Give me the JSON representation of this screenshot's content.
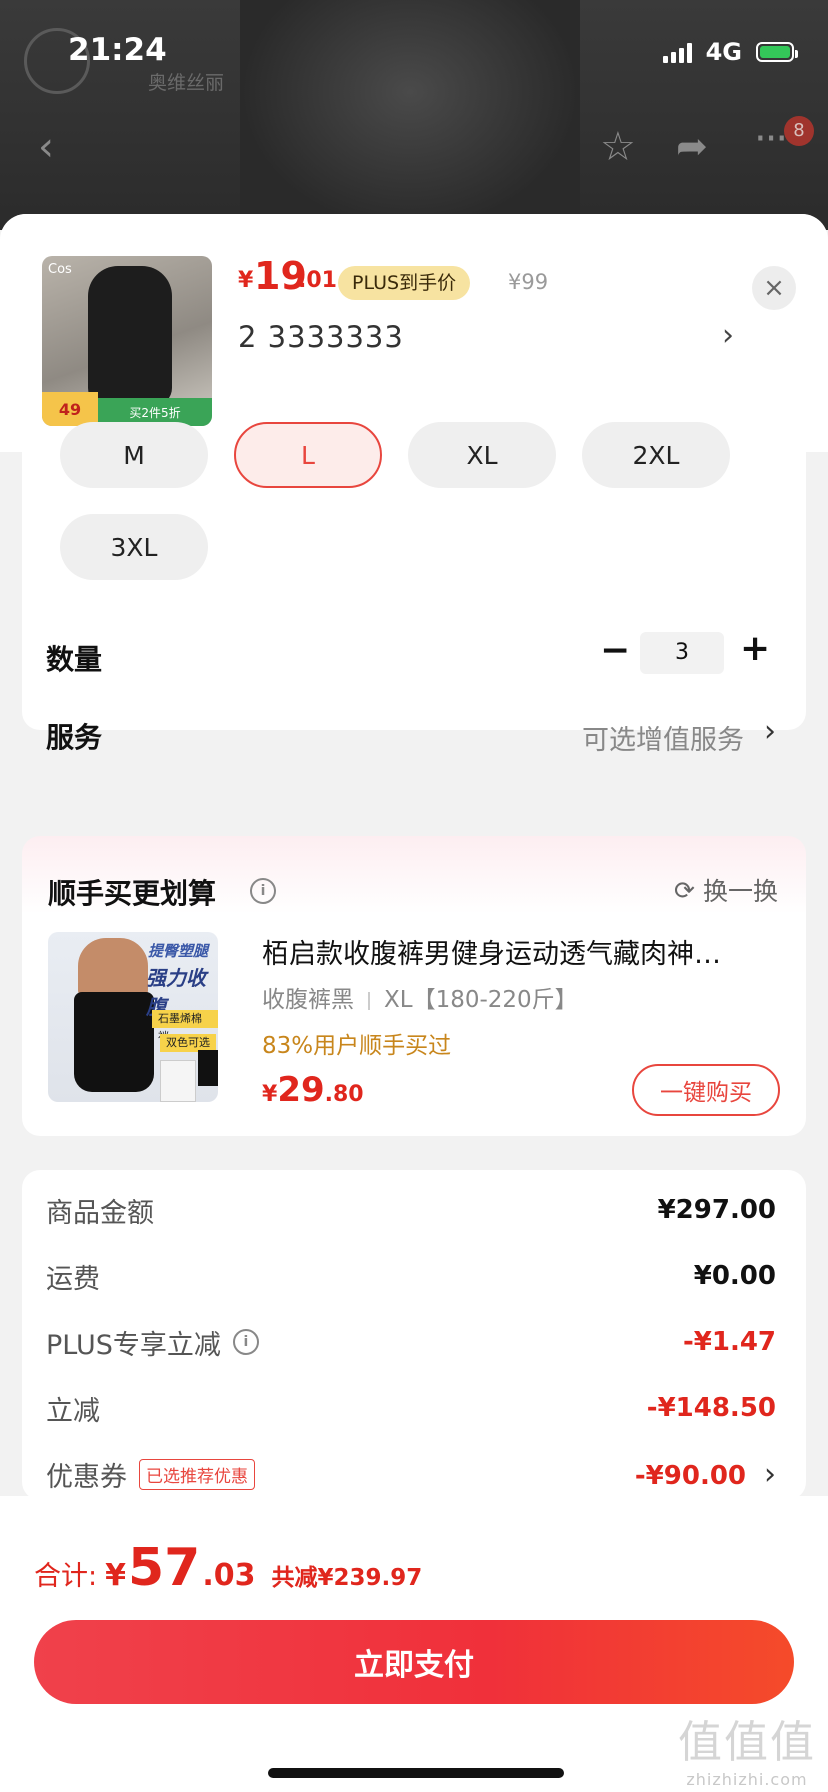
{
  "status_bar": {
    "time": "21:24",
    "network": "4G"
  },
  "background": {
    "brand": "奥维丝丽"
  },
  "nav": {
    "back_icon": "chevron-left-icon",
    "favorite_icon": "star-icon",
    "share_icon": "share-icon",
    "more_icon": "more-icon",
    "badge_count": "8"
  },
  "product": {
    "thumb_logo": "Cos",
    "thumb_price_badge": "49",
    "thumb_promo": "买2件5折",
    "price_symbol": "¥",
    "price_int": "19",
    "price_dec": ".01",
    "price_tag": "PLUS到手价",
    "original_price": "¥99",
    "selected_spec": "2  3333333",
    "close_label": "×"
  },
  "sizes": {
    "options": [
      "M",
      "L",
      "XL",
      "2XL",
      "3XL"
    ],
    "selected": "L"
  },
  "quantity": {
    "label": "数量",
    "minus": "−",
    "value": "3",
    "plus": "+"
  },
  "service": {
    "label": "服务",
    "value": "可选增值服务"
  },
  "addon": {
    "title": "顺手买更划算",
    "swap_label": "换一换",
    "thumb_text1": "提臀塑腿",
    "thumb_text2": "强力收腹",
    "thumb_tag1": "石墨烯棉裆",
    "thumb_tag2": "双色可选",
    "name": "栢启款收腹裤男健身运动透气藏肉神…",
    "color": "收腹裤黑",
    "size": "XL【180-220斤】",
    "social_proof": "83%用户顺手买过",
    "price_symbol": "¥",
    "price_int": "29",
    "price_dec": ".80",
    "buy_label": "一键购买"
  },
  "summary": {
    "rows": [
      {
        "label": "商品金额",
        "value": "¥297.00"
      },
      {
        "label": "运费",
        "value": "¥0.00"
      },
      {
        "label": "PLUS专享立减",
        "value": "-¥1.47"
      },
      {
        "label": "立减",
        "value": "-¥148.50"
      },
      {
        "label": "优惠券",
        "value": "-¥90.00",
        "tag": "已选推荐优惠"
      }
    ]
  },
  "footer": {
    "total_label": "合计:",
    "total_symbol": "¥",
    "total_int": "57",
    "total_dec": ".03",
    "total_saving": "共减¥239.97",
    "pay_label": "立即支付",
    "watermark_main": "值值值",
    "watermark_url": "zhizhizhi.com"
  },
  "colors": {
    "accent": "#e0261d",
    "plus_tag_bg": "#f7e3a1",
    "pay_button": "#f0303a"
  }
}
